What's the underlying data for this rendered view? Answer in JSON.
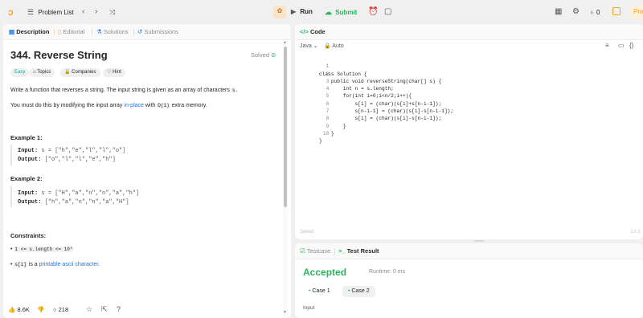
{
  "topbar": {
    "problem_list": "Problem List",
    "run": "Run",
    "submit": "Submit",
    "streak": "0",
    "premium": "Pre"
  },
  "desc_panel": {
    "tabs": [
      {
        "label": "Description"
      },
      {
        "label": "Editorial"
      },
      {
        "label": "Solutions"
      },
      {
        "label": "Submissions"
      }
    ],
    "title": "344. Reverse String",
    "status": "Solved",
    "chips": {
      "difficulty": "Easy",
      "topics": "Topics",
      "companies": "Companies",
      "hint": "Hint"
    },
    "para1_prefix": "Write a function that reverses a string. The input string is given as an array of characters",
    "para1_code": "s",
    "para1_suffix": ".",
    "para2_prefix": "You must do this by modifying the input array",
    "para2_link": "in-place",
    "para2_mid": "with",
    "para2_code": "O(1)",
    "para2_suffix": "extra memory.",
    "example1": {
      "heading": "Example 1:",
      "input_label": "Input:",
      "input_value": "s = [\"h\",\"e\",\"l\",\"l\",\"o\"]",
      "output_label": "Output:",
      "output_value": "[\"o\",\"l\",\"l\",\"e\",\"h\"]"
    },
    "example2": {
      "heading": "Example 2:",
      "input_label": "Input:",
      "input_value": "s = [\"H\",\"a\",\"n\",\"n\",\"a\",\"h\"]",
      "output_label": "Output:",
      "output_value": "[\"h\",\"a\",\"n\",\"n\",\"a\",\"H\"]"
    },
    "constraints_heading": "Constraints:",
    "constraint1": "1 <= s.length <= 10⁵",
    "constraint2_code": "s[i]",
    "constraint2_mid": "is a",
    "constraint2_link": "printable ascii character",
    "constraint2_suffix": ".",
    "likes": "8.6K",
    "comments": "218"
  },
  "code_panel": {
    "title": "Code",
    "language": "Java",
    "auto": "Auto",
    "saved": "Saved",
    "cursor": "Ln 1",
    "lines": [
      "class Solution {",
      "    public void reverseString(char[] s) {",
      "        int n = s.length;",
      "        for(int i=0;i<n/2;i++){",
      "            s[i] = (char)(s[i]+s[n-i-1]);",
      "            s[n-i-1] = (char)(s[i]-s[n-i-1]);",
      "            s[i] = (char)(s[i]-s[n-i-1]);",
      "        }",
      "    }",
      "}"
    ]
  },
  "result_panel": {
    "tab_testcase": "Testcase",
    "tab_result": "Test Result",
    "verdict": "Accepted",
    "runtime": "Runtime: 0 ms",
    "case1": "Case 1",
    "case2": "Case 2",
    "input_label": "Input"
  },
  "colors": {
    "accent_orange": "#ffa116",
    "easy": "#00af9b",
    "link": "#1a73e8",
    "accepted": "#2db55d"
  }
}
